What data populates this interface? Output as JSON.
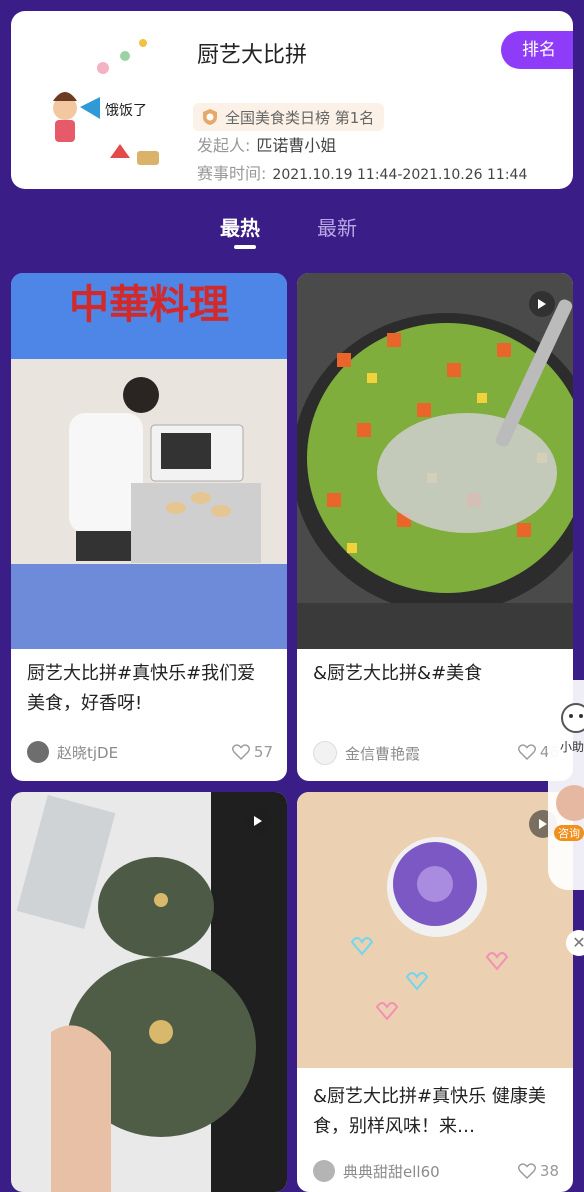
{
  "header": {
    "title": "厨艺大比拼",
    "rank_button": "排名",
    "badge": "全国美食类日榜  第1名",
    "initiator_label": "发起人:",
    "initiator": "匹诺曹小姐",
    "time_label": "赛事时间:",
    "time": "2021.10.19 11:44-2021.10.26 11:44",
    "cover_text": "饿饭了"
  },
  "tabs": [
    {
      "label": "最热",
      "active": true
    },
    {
      "label": "最新",
      "active": false
    }
  ],
  "posts": [
    {
      "caption": "厨艺大比拼#真快乐#我们爱美食，好香呀!",
      "author": "赵晓tjDE",
      "likes": "57",
      "banner": "中華料理"
    },
    {
      "caption": "&厨艺大比拼&#美食",
      "author": "金信曹艳霞",
      "likes": "46"
    },
    {
      "caption": "",
      "author": "",
      "likes": ""
    },
    {
      "caption": "&厨艺大比拼#真快乐 健康美食，别样风味！来…",
      "author": "典典甜甜ell60",
      "likes": "38"
    }
  ],
  "float_widget": {
    "label1": "小助",
    "label2": "咨询"
  },
  "colors": {
    "bg": "#3a1d86",
    "accent": "#8e3cf7"
  }
}
